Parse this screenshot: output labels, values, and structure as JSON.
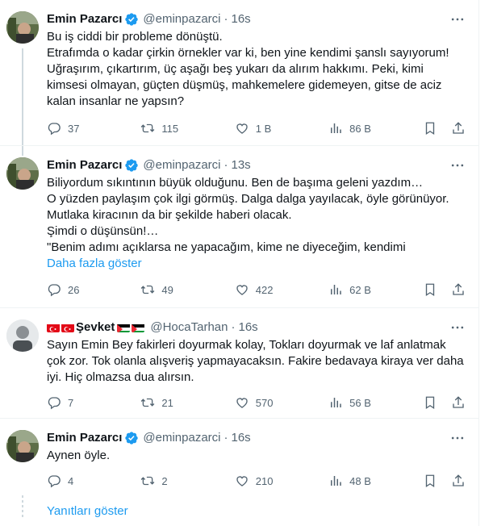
{
  "tweets": [
    {
      "name": "Emin Pazarcı",
      "handle": "@eminpazarci",
      "time": "16s",
      "text": "Bu iş ciddi bir probleme dönüştü.\nEtrafımda o kadar çirkin örnekler var ki, ben yine kendimi şanslı sayıyorum!\nUğraşırım, çıkartırım, üç aşağı beş yukarı da alırım hakkımı. Peki, kimi kimsesi olmayan, güçten düşmüş, mahkemelere gidemeyen, gitse de aciz kalan insanlar ne yapsın?",
      "replies": "37",
      "retweets": "115",
      "likes": "1 B",
      "views": "86 B"
    },
    {
      "name": "Emin Pazarcı",
      "handle": "@eminpazarci",
      "time": "13s",
      "text": "Biliyordum sıkıntının büyük olduğunu. Ben de başıma geleni yazdım…\nO yüzden paylaşım çok ilgi görmüş. Dalga dalga yayılacak, öyle görünüyor.\nMutlaka kiracının da bir şekilde haberi olacak.\nŞimdi o düşünsün!…\n\"Benim adımı açıklarsa ne yapacağım, kime ne diyeceğim, kendimi",
      "show_more": "Daha fazla göster",
      "replies": "26",
      "retweets": "49",
      "likes": "422",
      "views": "62 B"
    },
    {
      "name": "Şevket",
      "handle": "@HocaTarhan",
      "time": "16s",
      "text": "Sayın Emin Bey fakirleri doyurmak kolay, Tokları doyurmak ve laf anlatmak çok zor. Tok olanla alışveriş yapmayacaksın. Fakire bedavaya kiraya ver daha iyi. Hiç olmazsa dua alırsın.",
      "replies": "7",
      "retweets": "21",
      "likes": "570",
      "views": "56 B"
    },
    {
      "name": "Emin Pazarcı",
      "handle": "@eminpazarci",
      "time": "16s",
      "text": "Aynen öyle.",
      "replies": "4",
      "retweets": "2",
      "likes": "210",
      "views": "48 B"
    }
  ],
  "show_replies": "Yanıtları göster",
  "colors": {
    "accent": "#1d9bf0",
    "muted": "#536471",
    "text": "#0f1419",
    "border": "#eff3f4"
  }
}
